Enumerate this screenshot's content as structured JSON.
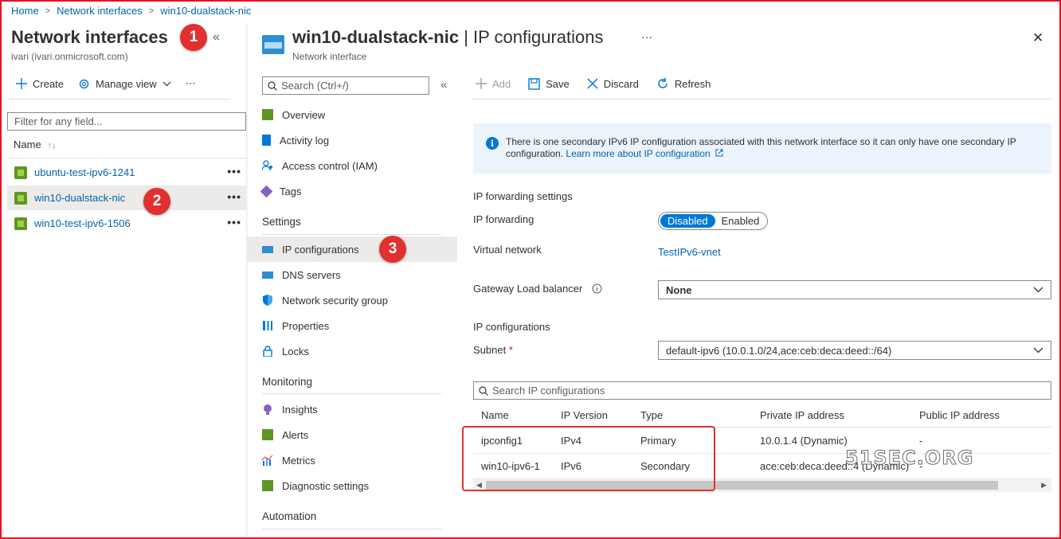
{
  "breadcrumb": [
    "Home",
    "Network interfaces",
    "win10-dualstack-nic"
  ],
  "left": {
    "title": "Network interfaces",
    "subtitle": "ivari (ivari.onmicrosoft.com)",
    "collapse_icon": "«",
    "toolbar": {
      "create": "Create",
      "manage_view": "Manage view",
      "more": "⋯"
    },
    "filter_placeholder": "Filter for any field...",
    "column_name": "Name",
    "sort_icon": "↑↓",
    "items": [
      {
        "name": "ubuntu-test-ipv6-1241",
        "dots": "•••"
      },
      {
        "name": "win10-dualstack-nic",
        "dots": "•••"
      },
      {
        "name": "win10-test-ipv6-1506",
        "dots": "•••"
      }
    ]
  },
  "badges": {
    "b1": "1",
    "b2": "2",
    "b3": "3"
  },
  "main": {
    "title_resource": "win10-dualstack-nic",
    "title_sep": " | ",
    "title_page": "IP configurations",
    "subtitle": "Network interface",
    "more": "···",
    "close": "✕"
  },
  "menu": {
    "search_placeholder": "Search (Ctrl+/)",
    "collapse": "«",
    "items_top": [
      "Overview",
      "Activity log",
      "Access control (IAM)",
      "Tags"
    ],
    "settings_label": "Settings",
    "settings_items": [
      "IP configurations",
      "DNS servers",
      "Network security group",
      "Properties",
      "Locks"
    ],
    "monitoring_label": "Monitoring",
    "monitoring_items": [
      "Insights",
      "Alerts",
      "Metrics",
      "Diagnostic settings"
    ],
    "automation_label": "Automation"
  },
  "content": {
    "toolbar": {
      "add": "Add",
      "save": "Save",
      "discard": "Discard",
      "refresh": "Refresh"
    },
    "info_text": "There is one secondary IPv6 IP configuration associated with this network interface so it can only have one secondary IP configuration.",
    "info_link": "Learn more about IP configuration",
    "ip_forwarding_settings": "IP forwarding settings",
    "ip_forwarding_label": "IP forwarding",
    "toggle": {
      "disabled": "Disabled",
      "enabled": "Enabled"
    },
    "virtual_network_label": "Virtual network",
    "virtual_network_value": "TestIPv6-vnet",
    "gateway_lb_label": "Gateway Load balancer",
    "gateway_lb_value": "None",
    "ip_configurations_label": "IP configurations",
    "subnet_label": "Subnet",
    "subnet_required": "*",
    "subnet_value": "default-ipv6 (10.0.1.0/24,ace:ceb:deca:deed::/64)",
    "grid_search_placeholder": "Search IP configurations",
    "columns": [
      "Name",
      "IP Version",
      "Type",
      "Private IP address",
      "Public IP address"
    ],
    "rows": [
      [
        "ipconfig1",
        "IPv4",
        "Primary",
        "10.0.1.4 (Dynamic)",
        "-"
      ],
      [
        "win10-ipv6-1",
        "IPv6",
        "Secondary",
        "ace:ceb:deca:deed::4 (Dynamic)",
        "-"
      ]
    ]
  },
  "watermark": "51SEC.ORG",
  "colors": {
    "accent": "#0078d4",
    "link": "#0063b1",
    "badge": "#e0302f"
  }
}
